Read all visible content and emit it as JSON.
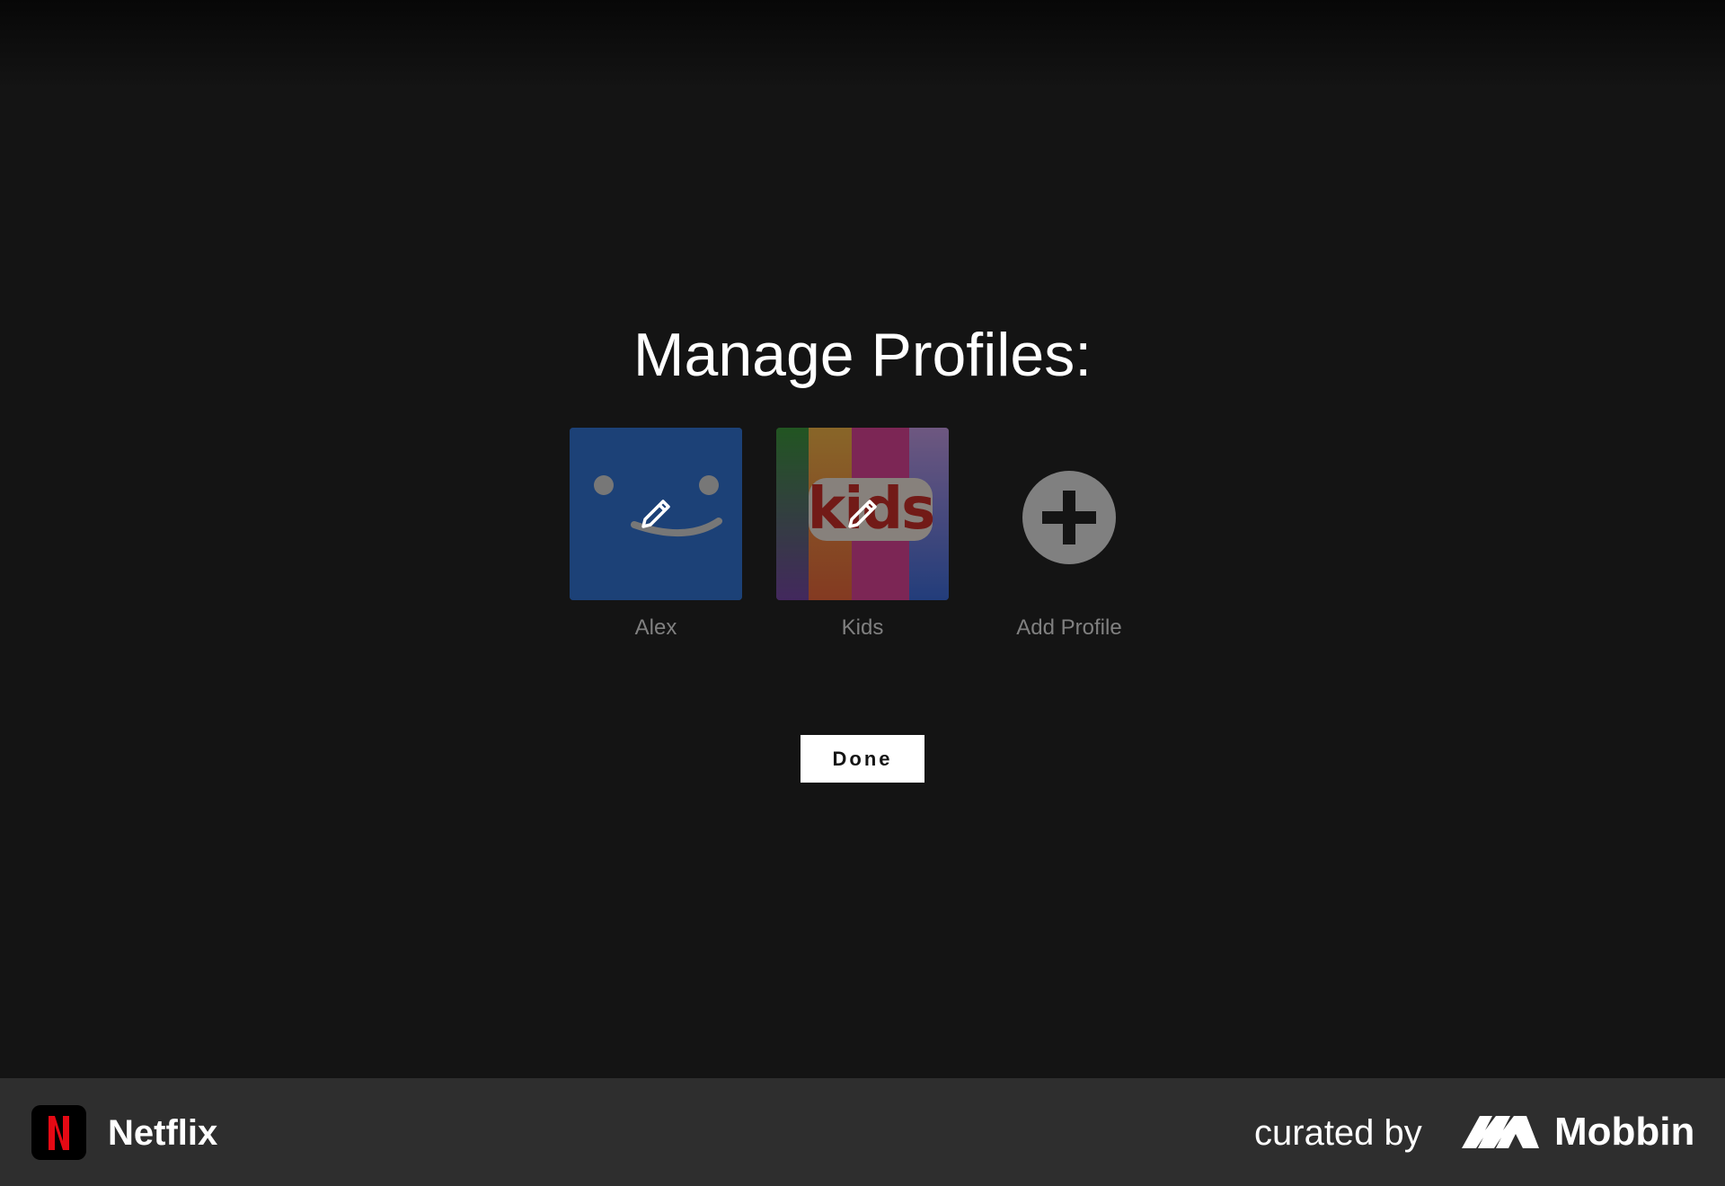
{
  "page": {
    "title": "Manage Profiles:"
  },
  "profiles": [
    {
      "name": "Alex",
      "avatar": "smiley-avatar",
      "color": "#2367c8"
    },
    {
      "name": "Kids",
      "avatar": "kids-avatar",
      "badge_text": "kids",
      "stripe_colors": [
        "#2e8b2e",
        "#e8a93a",
        "#e05a2e",
        "#d2358a",
        "#c9348a",
        "#8c6fb8",
        "#2f5fcf"
      ]
    }
  ],
  "add_profile": {
    "label": "Add Profile",
    "icon": "plus-circle-icon"
  },
  "actions": {
    "done_label": "Done"
  },
  "footer": {
    "app_name": "Netflix",
    "curated_by": "curated by",
    "brand": "Mobbin"
  },
  "colors": {
    "background": "#141414",
    "footer_background": "#2e2e2e",
    "netflix_red": "#e50914"
  }
}
